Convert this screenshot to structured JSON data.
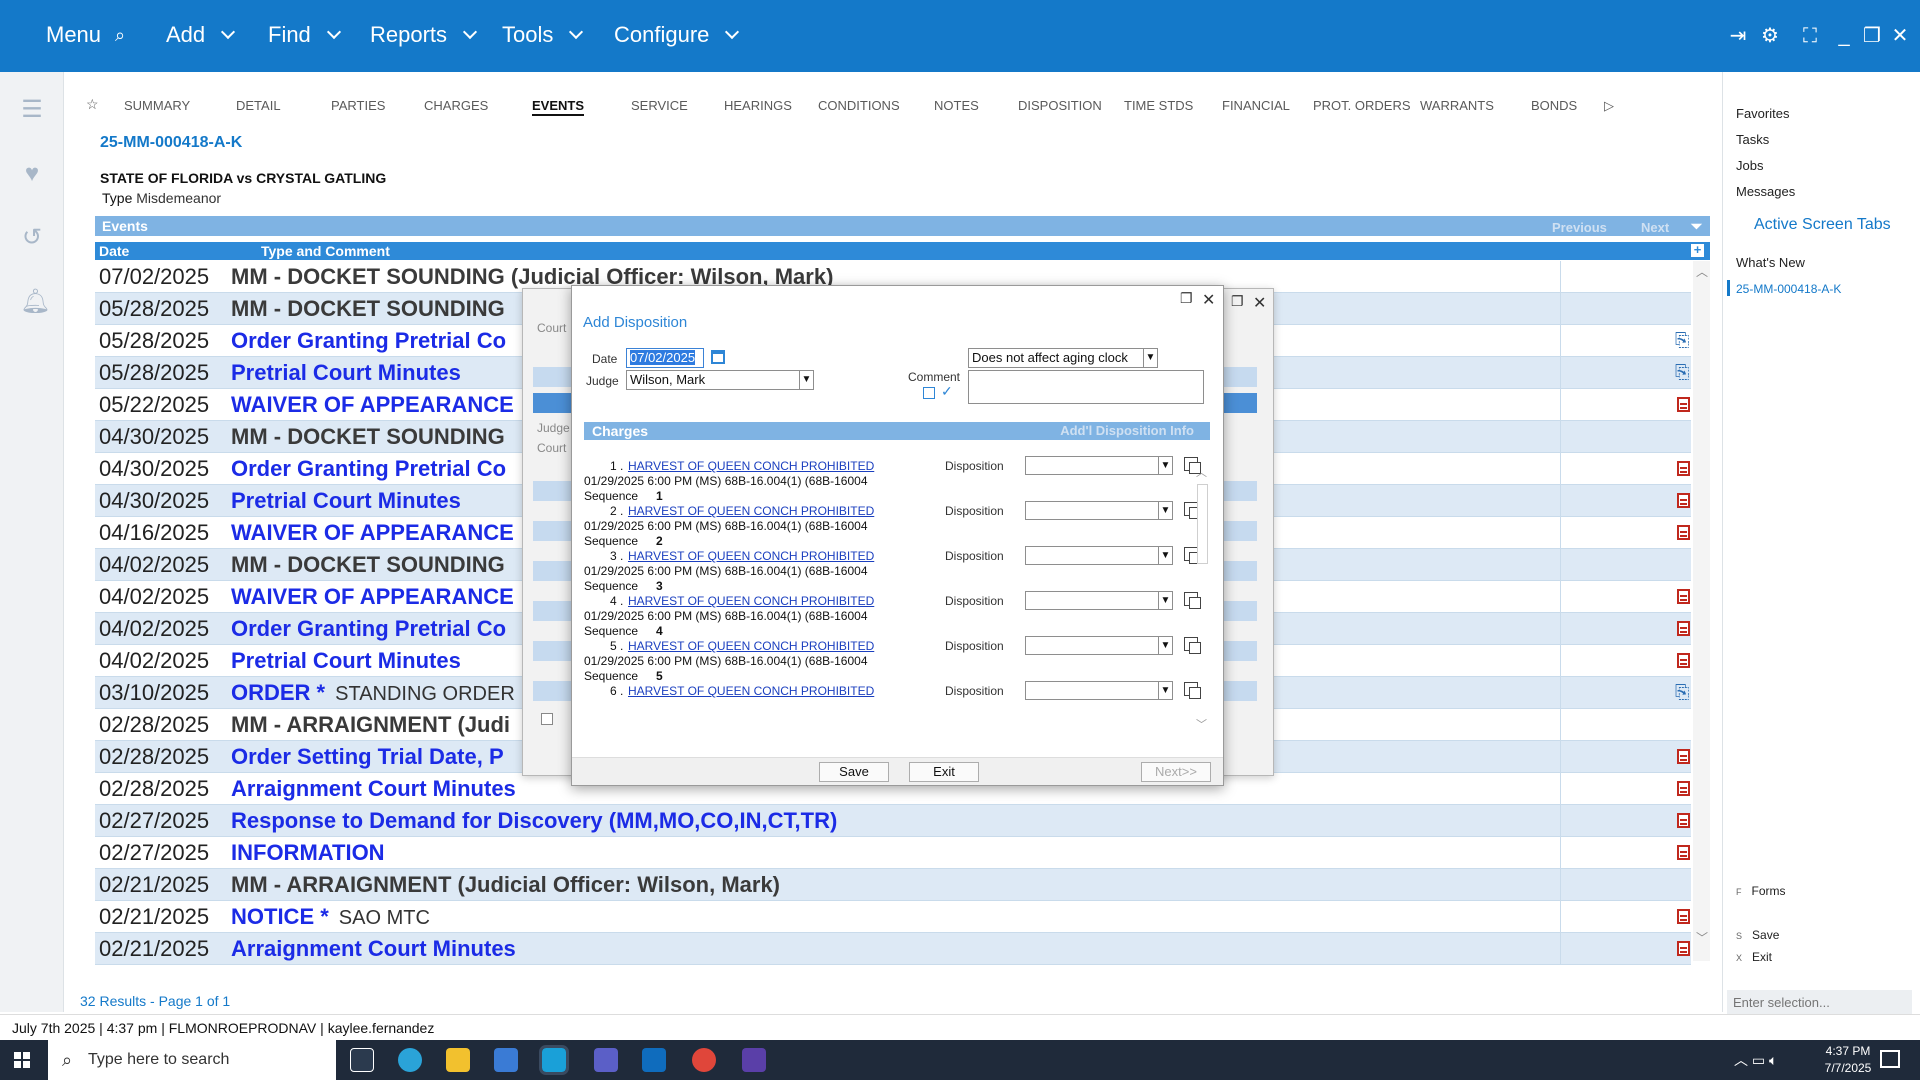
{
  "topbar": {
    "menus": [
      {
        "label": "Menu",
        "icon": "search-icon"
      },
      {
        "label": "Add"
      },
      {
        "label": "Find"
      },
      {
        "label": "Reports"
      },
      {
        "label": "Tools"
      },
      {
        "label": "Configure"
      }
    ]
  },
  "tabs": [
    "SUMMARY",
    "DETAIL",
    "PARTIES",
    "CHARGES",
    "EVENTS",
    "SERVICE",
    "HEARINGS",
    "CONDITIONS",
    "NOTES",
    "DISPOSITION",
    "TIME STDS",
    "FINANCIAL",
    "PROT. ORDERS",
    "WARRANTS",
    "BONDS"
  ],
  "active_tab": "EVENTS",
  "case": {
    "number": "25-MM-000418-A-K",
    "title": "STATE OF FLORIDA vs CRYSTAL GATLING",
    "type_label": "Type",
    "type_value": "Misdemeanor"
  },
  "events": {
    "header": "Events",
    "previous": "Previous",
    "next": "Next",
    "col_date": "Date",
    "col_type": "Type and Comment",
    "rows": [
      {
        "date": "07/02/2025",
        "type": "MM - DOCKET SOUNDING (Judicial Officer: Wilson, Mark)",
        "comment": "",
        "style": "gray",
        "icon": ""
      },
      {
        "date": "05/28/2025",
        "type": "MM - DOCKET SOUNDING",
        "comment": "",
        "style": "gray",
        "icon": ""
      },
      {
        "date": "05/28/2025",
        "type": "Order Granting Pretrial Co",
        "comment": "",
        "style": "blue",
        "icon": "link"
      },
      {
        "date": "05/28/2025",
        "type": "Pretrial Court Minutes",
        "comment": "",
        "style": "blue",
        "icon": "link"
      },
      {
        "date": "05/22/2025",
        "type": "WAIVER OF APPEARANCE",
        "comment": "",
        "style": "blue",
        "icon": "doc"
      },
      {
        "date": "04/30/2025",
        "type": "MM - DOCKET SOUNDING",
        "comment": "",
        "style": "gray",
        "icon": ""
      },
      {
        "date": "04/30/2025",
        "type": "Order Granting Pretrial Co",
        "comment": "",
        "style": "blue",
        "icon": "doc"
      },
      {
        "date": "04/30/2025",
        "type": "Pretrial Court Minutes",
        "comment": "",
        "style": "blue",
        "icon": "doc"
      },
      {
        "date": "04/16/2025",
        "type": "WAIVER OF APPEARANCE",
        "comment": "",
        "style": "blue",
        "icon": "doc"
      },
      {
        "date": "04/02/2025",
        "type": "MM - DOCKET SOUNDING",
        "comment": "",
        "style": "gray",
        "icon": ""
      },
      {
        "date": "04/02/2025",
        "type": "WAIVER OF APPEARANCE",
        "comment": "",
        "style": "blue",
        "icon": "doc"
      },
      {
        "date": "04/02/2025",
        "type": "Order Granting Pretrial Co",
        "comment": "",
        "style": "blue",
        "icon": "doc"
      },
      {
        "date": "04/02/2025",
        "type": "Pretrial Court Minutes",
        "comment": "",
        "style": "blue",
        "icon": "doc"
      },
      {
        "date": "03/10/2025",
        "type": "ORDER *",
        "comment": "STANDING ORDER F",
        "style": "blue",
        "icon": "link"
      },
      {
        "date": "02/28/2025",
        "type": "MM - ARRAIGNMENT (Judi",
        "comment": "",
        "style": "gray",
        "icon": ""
      },
      {
        "date": "02/28/2025",
        "type": "Order Setting Trial Date, P",
        "comment": "",
        "style": "blue",
        "icon": "doc"
      },
      {
        "date": "02/28/2025",
        "type": "Arraignment Court Minutes",
        "comment": "",
        "style": "blue",
        "icon": "doc"
      },
      {
        "date": "02/27/2025",
        "type": "Response to Demand for Discovery (MM,MO,CO,IN,CT,TR)",
        "comment": "",
        "style": "blue",
        "icon": "doc"
      },
      {
        "date": "02/27/2025",
        "type": "INFORMATION",
        "comment": "",
        "style": "blue",
        "icon": "doc"
      },
      {
        "date": "02/21/2025",
        "type": "MM - ARRAIGNMENT (Judicial Officer: Wilson, Mark)",
        "comment": "",
        "style": "gray",
        "icon": ""
      },
      {
        "date": "02/21/2025",
        "type": "NOTICE *",
        "comment": "SAO MTC",
        "style": "blue",
        "icon": "doc"
      },
      {
        "date": "02/21/2025",
        "type": "Arraignment Court Minutes",
        "comment": "",
        "style": "blue",
        "icon": "doc"
      }
    ],
    "results": "32 Results - Page 1 of 1"
  },
  "right_panel": {
    "items": [
      "Favorites",
      "Tasks",
      "Jobs",
      "Messages"
    ],
    "active_tabs_label": "Active Screen Tabs",
    "whats_new": "What's New",
    "active_case": "25-MM-000418-A-K",
    "shortcuts": [
      {
        "key": "F",
        "label": "Forms"
      },
      {
        "key": "S",
        "label": "Save"
      },
      {
        "key": "X",
        "label": "Exit"
      }
    ],
    "selection_placeholder": "Enter selection..."
  },
  "status": {
    "date": "July 7th 2025",
    "time": "4:37 pm",
    "server": "FLMONROEPRODNAV",
    "user": "kaylee.fernandez"
  },
  "taskbar": {
    "search_placeholder": "Type here to search",
    "clock_time": "4:37 PM",
    "clock_date": "7/7/2025"
  },
  "dialog": {
    "title": "Add Disposition",
    "date_label": "Date",
    "date_value": "07/02/2025",
    "judge_label": "Judge",
    "judge_value": "Wilson, Mark",
    "aging_value": "Does not affect aging clock",
    "comment_label": "Comment",
    "charges_header": "Charges",
    "addl_info": "Add'l Disposition Info",
    "disposition_label": "Disposition",
    "sequence_label": "Sequence",
    "charges": [
      {
        "num": "1 .",
        "name": "HARVEST OF QUEEN CONCH PROHIBITED",
        "detail": "01/29/2025 6:00 PM (MS) 68B-16.004(1) (68B-16004",
        "seq": "1"
      },
      {
        "num": "2 .",
        "name": "HARVEST OF QUEEN CONCH PROHIBITED",
        "detail": "01/29/2025 6:00 PM (MS) 68B-16.004(1) (68B-16004",
        "seq": "2"
      },
      {
        "num": "3 .",
        "name": "HARVEST OF QUEEN CONCH PROHIBITED",
        "detail": "01/29/2025 6:00 PM (MS) 68B-16.004(1) (68B-16004",
        "seq": "3"
      },
      {
        "num": "4 .",
        "name": "HARVEST OF QUEEN CONCH PROHIBITED",
        "detail": "01/29/2025 6:00 PM (MS) 68B-16.004(1) (68B-16004",
        "seq": "4"
      },
      {
        "num": "5 .",
        "name": "HARVEST OF QUEEN CONCH PROHIBITED",
        "detail": "01/29/2025 6:00 PM (MS) 68B-16.004(1) (68B-16004",
        "seq": "5"
      },
      {
        "num": "6 .",
        "name": "HARVEST OF QUEEN CONCH PROHIBITED",
        "detail": "",
        "seq": ""
      }
    ],
    "save": "Save",
    "exit": "Exit",
    "next": "Next>>"
  },
  "bg_dialog": {
    "labels": [
      "Court",
      "Judge",
      "Court"
    ]
  },
  "colors": {
    "brand": "#1479c9",
    "header_light": "#7fb3e3",
    "header_dark": "#2e8ad8",
    "row_alt": "#dde9f5",
    "event_blue": "#1b2be6"
  }
}
